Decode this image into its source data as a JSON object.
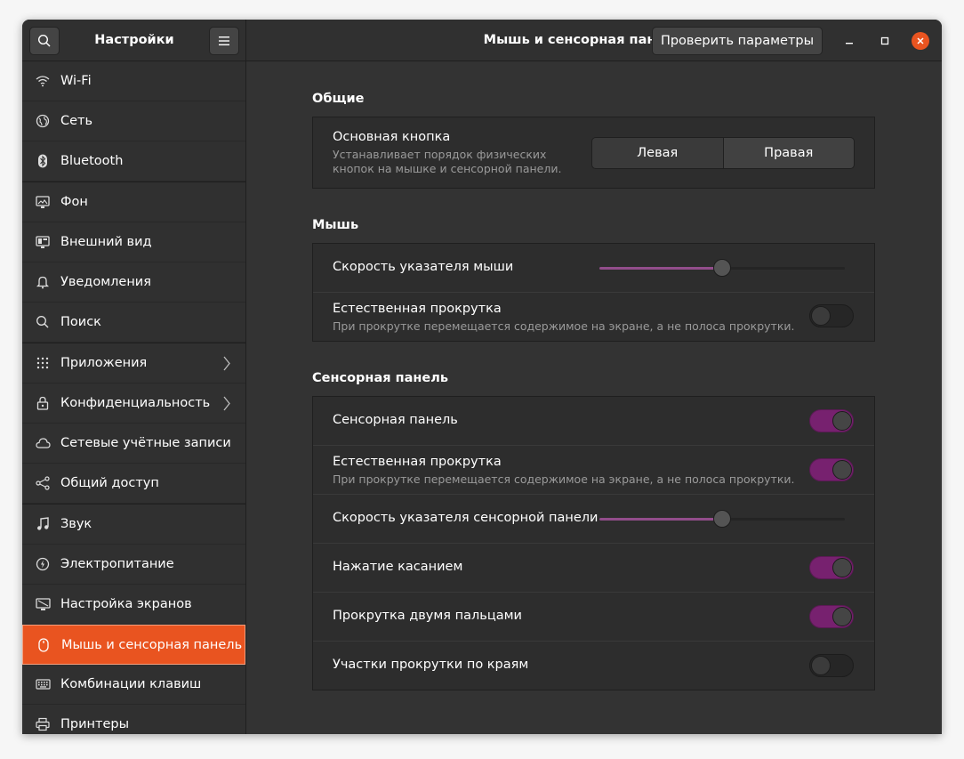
{
  "header": {
    "app_title": "Настройки",
    "page_title": "Мышь и сенсорная панель",
    "test_button": "Проверить параметры"
  },
  "sidebar": {
    "items": [
      {
        "label": "Wi-Fi",
        "icon": "wifi-icon"
      },
      {
        "label": "Сеть",
        "icon": "network-icon"
      },
      {
        "label": "Bluetooth",
        "icon": "bluetooth-icon"
      },
      {
        "label": "Фон",
        "icon": "background-icon"
      },
      {
        "label": "Внешний вид",
        "icon": "appearance-icon"
      },
      {
        "label": "Уведомления",
        "icon": "bell-icon"
      },
      {
        "label": "Поиск",
        "icon": "search-icon"
      },
      {
        "label": "Приложения",
        "icon": "apps-grid-icon"
      },
      {
        "label": "Конфиденциальность",
        "icon": "lock-icon"
      },
      {
        "label": "Сетевые учётные записи",
        "icon": "cloud-icon"
      },
      {
        "label": "Общий доступ",
        "icon": "share-icon"
      },
      {
        "label": "Звук",
        "icon": "music-note-icon"
      },
      {
        "label": "Электропитание",
        "icon": "power-icon"
      },
      {
        "label": "Настройка экранов",
        "icon": "display-icon"
      },
      {
        "label": "Мышь и сенсорная панель",
        "icon": "mouse-icon",
        "active": true
      },
      {
        "label": "Комбинации клавиш",
        "icon": "keyboard-icon"
      },
      {
        "label": "Принтеры",
        "icon": "printer-icon"
      }
    ]
  },
  "general": {
    "title": "Общие",
    "primary_button": {
      "label": "Основная кнопка",
      "description_line1": "Устанавливает порядок физических",
      "description_line2": "кнопок на мышке и сенсорной панели.",
      "options": [
        "Левая",
        "Правая"
      ],
      "selected": "Левая"
    }
  },
  "mouse": {
    "title": "Мышь",
    "speed_label": "Скорость указателя мыши",
    "speed_value": 0.5,
    "natural_scroll_label": "Естественная прокрутка",
    "natural_scroll_desc": "При прокрутке перемещается содержимое на экране, а не полоса прокрутки.",
    "natural_scroll_on": false
  },
  "touchpad": {
    "title": "Сенсорная панель",
    "enabled_label": "Сенсорная панель",
    "enabled_on": true,
    "natural_scroll_label": "Естественная прокрутка",
    "natural_scroll_desc": "При прокрутке перемещается содержимое на экране, а не полоса прокрутки.",
    "natural_scroll_on": true,
    "speed_label": "Скорость указателя сенсорной панели",
    "speed_value": 0.5,
    "tap_to_click_label": "Нажатие касанием",
    "tap_to_click_on": true,
    "two_finger_label": "Прокрутка двумя пальцами",
    "two_finger_on": true,
    "edge_scroll_label": "Участки прокрутки по краям",
    "edge_scroll_on": false
  },
  "colors": {
    "accent": "#e95420",
    "toggle_on": "#77216f",
    "slider_fill": "#924d8b"
  }
}
